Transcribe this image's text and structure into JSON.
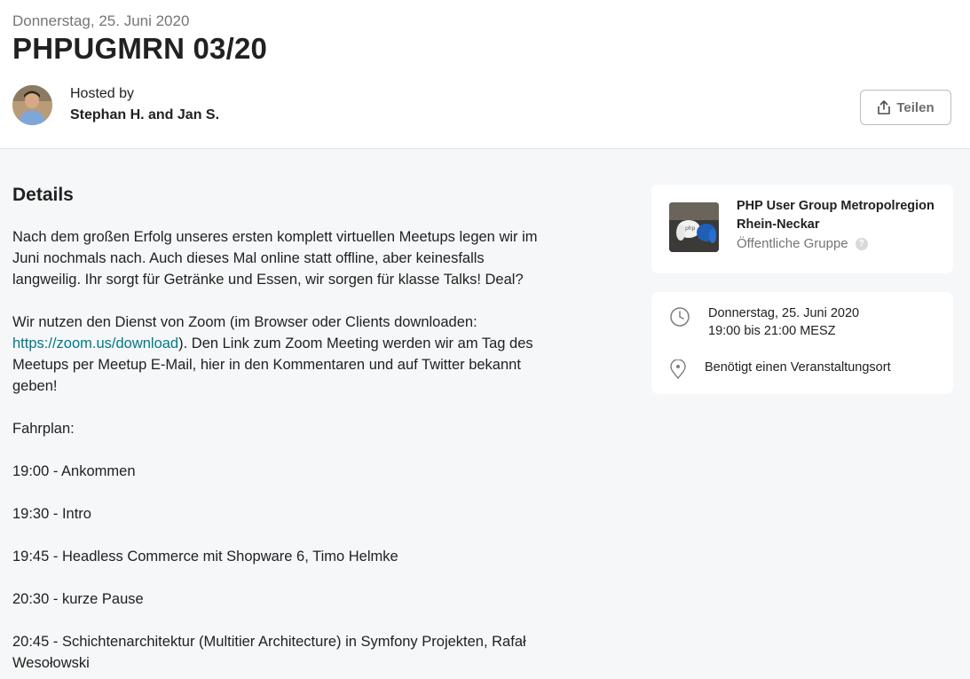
{
  "event": {
    "date": "Donnerstag, 25. Juni 2020",
    "title": "PHPUGMRN 03/20",
    "hosted_label": "Hosted by",
    "hosts": "Stephan H. and Jan S.",
    "share_label": "Teilen"
  },
  "details": {
    "heading": "Details",
    "paragraph1": "Nach dem großen Erfolg unseres ersten komplett virtuellen Meetups legen wir im Juni nochmals nach. Auch dieses Mal online statt offline, aber keinesfalls langweilig. Ihr sorgt für Getränke und Essen, wir sorgen für klasse Talks! Deal?",
    "paragraph2_before": "Wir nutzen den Dienst von Zoom (im Browser oder Clients downloaden: ",
    "paragraph2_link": "https://zoom.us/download",
    "paragraph2_after": "). Den Link zum Zoom Meeting werden wir am Tag des Meetups per Meetup E-Mail, hier in den Kommentaren und auf Twitter bekannt geben!",
    "schedule_label": "Fahrplan:",
    "schedule": [
      "19:00 - Ankommen",
      "19:30 - Intro",
      "19:45 - Headless Commerce mit Shopware 6, Timo Helmke",
      "20:30 - kurze Pause",
      "20:45 - Schichtenarchitektur (Multitier Architecture) in Symfony Projekten, Rafał Wesołowski"
    ]
  },
  "group": {
    "name": "PHP User Group Metropolregion Rhein-Neckar",
    "type": "Öffentliche Gruppe",
    "help": "?"
  },
  "time": {
    "date": "Donnerstag, 25. Juni 2020",
    "range": "19:00 bis 21:00 MESZ",
    "location": "Benötigt einen Veranstaltungsort"
  },
  "icons": {
    "share": "share-icon",
    "clock": "clock-icon",
    "pin": "map-pin-icon",
    "help": "help-icon"
  },
  "colors": {
    "link": "#00798a",
    "page_background": "#f6f7f8",
    "muted_text": "#757575"
  }
}
